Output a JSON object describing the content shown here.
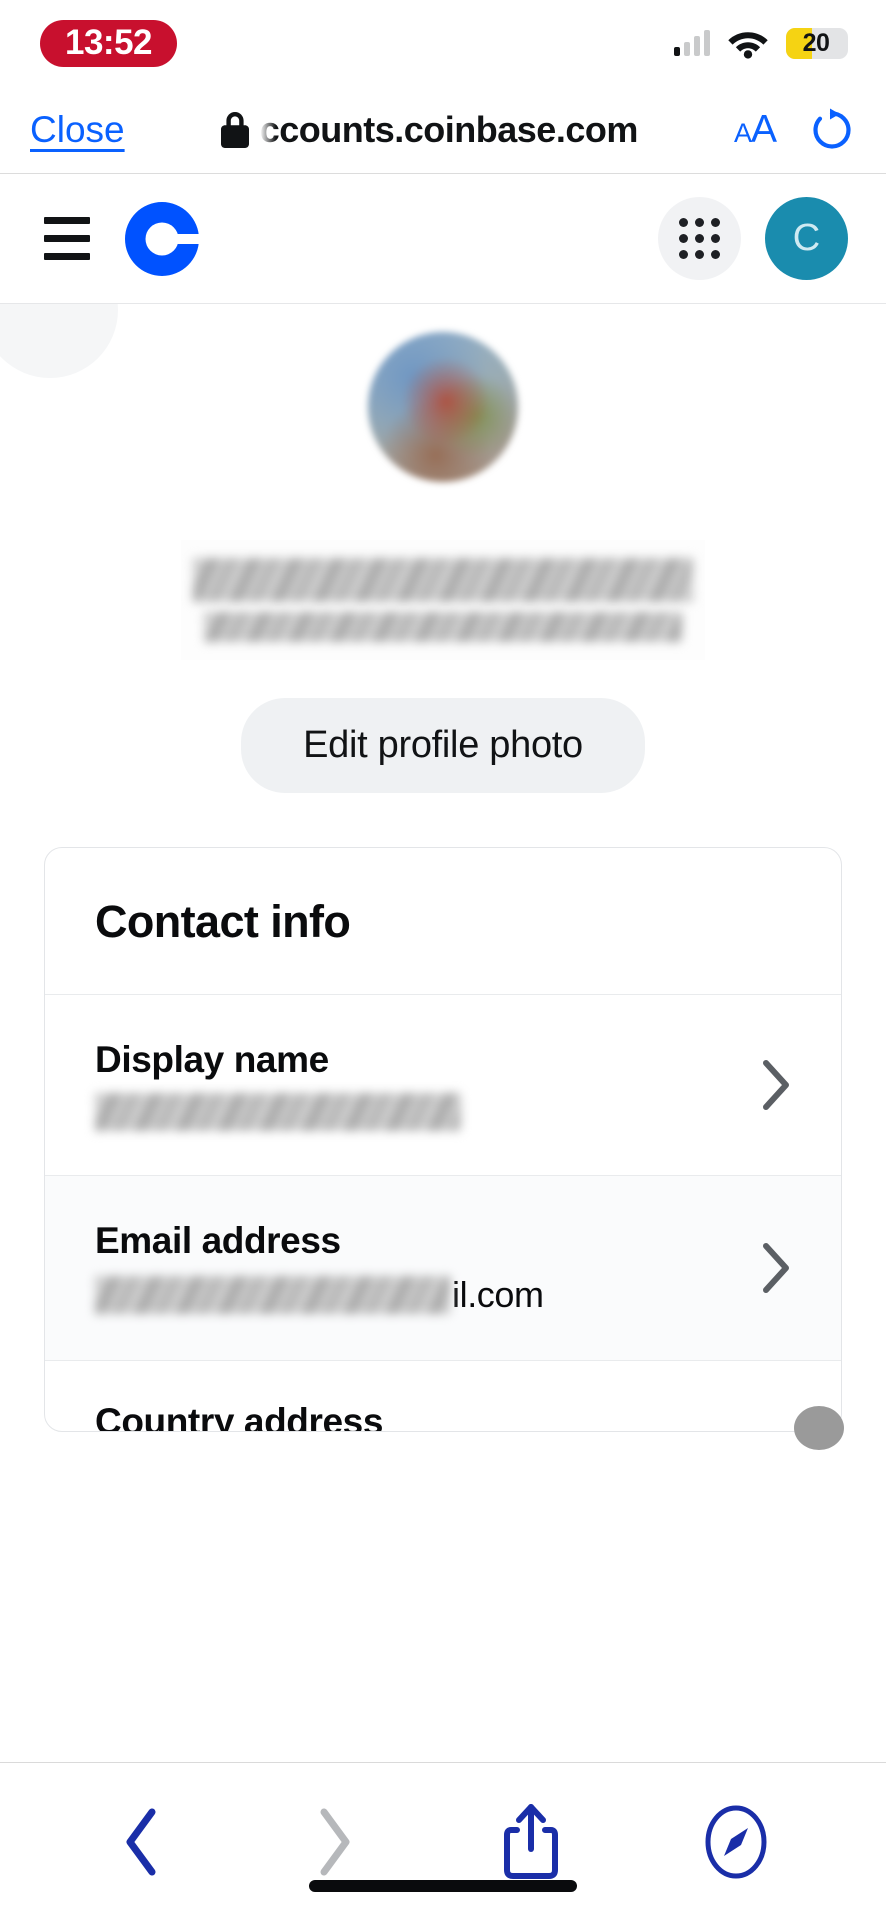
{
  "status_bar": {
    "time": "13:52",
    "time_pill_color": "#c8102e",
    "signal_bars_total": 4,
    "signal_bars_active": 1,
    "wifi_icon": "wifi-icon",
    "battery_percent": "20",
    "battery_fill_color": "#f5d313",
    "low_power_mode": true
  },
  "browser": {
    "close_label": "Close",
    "lock_icon": "lock-icon",
    "url": "ccounts.coinbase.com",
    "text_size_small": "A",
    "text_size_large": "A",
    "reload_icon": "reload-icon",
    "accent_color": "#0a61ff"
  },
  "site_header": {
    "menu_icon": "hamburger-menu-icon",
    "logo_icon": "coinbase-logo-icon",
    "logo_color": "#0052ff",
    "apps_icon": "apps-grid-icon",
    "avatar_initial": "C",
    "avatar_color": "#1a8cae"
  },
  "profile": {
    "photo_alt": "profile-photo",
    "name_redacted": true,
    "email_redacted": true,
    "edit_photo_label": "Edit profile photo"
  },
  "contact_card": {
    "title": "Contact info",
    "rows": [
      {
        "label": "Display name",
        "value_redacted": true,
        "value_tail": "",
        "accessory": "chevron-right-icon"
      },
      {
        "label": "Email address",
        "value_redacted": true,
        "value_tail": "il.com",
        "accessory": "chevron-right-icon"
      }
    ],
    "partial_row_label": "Country address"
  },
  "bottom_toolbar": {
    "back_icon": "back-chevron-icon",
    "back_enabled": true,
    "forward_icon": "forward-chevron-icon",
    "forward_enabled": false,
    "share_icon": "share-icon",
    "tabs_icon": "safari-compass-icon",
    "enabled_color": "#1a2ea8",
    "disabled_color": "#b6b8bb"
  }
}
